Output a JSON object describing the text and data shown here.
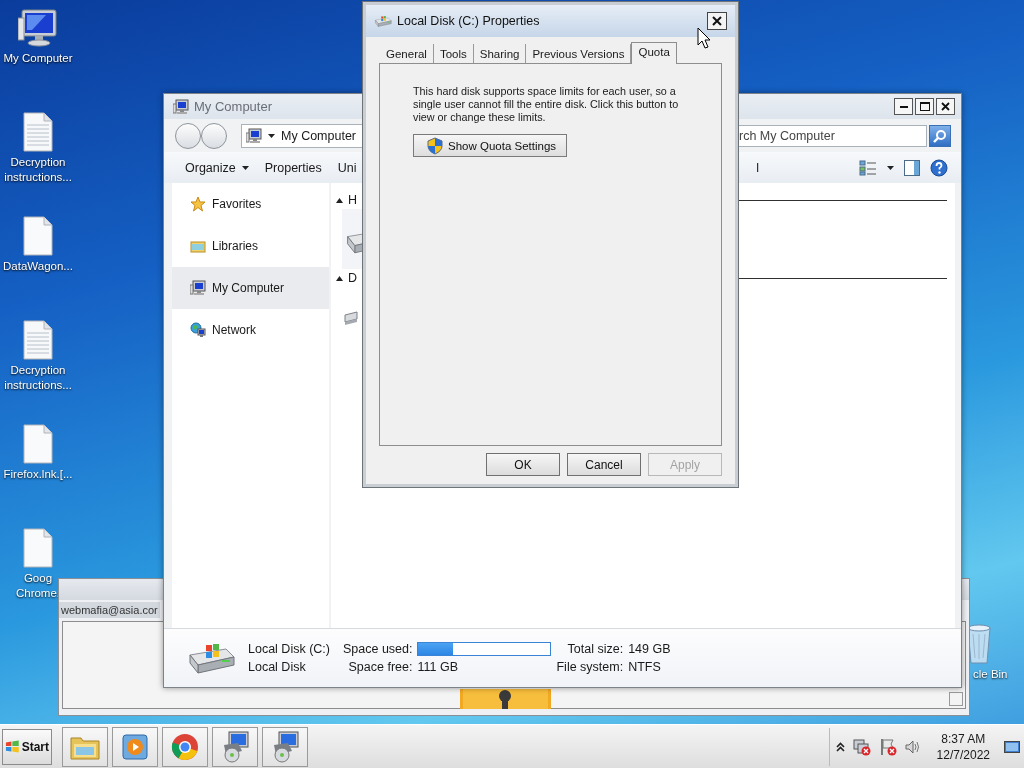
{
  "desktop": {
    "icons": [
      {
        "label": "My Computer",
        "kind": "computer"
      },
      {
        "label": "Decryption instructions...",
        "kind": "textfile"
      },
      {
        "label": "DataWagon...",
        "kind": "file"
      },
      {
        "label": "Decryption instructions...",
        "kind": "textfile"
      },
      {
        "label": "Firefox.lnk.[...",
        "kind": "file"
      },
      {
        "label": "Goog\nChrome.",
        "kind": "file"
      }
    ],
    "recycle_bin": {
      "label": "cle Bin"
    }
  },
  "background_window": {
    "field_value": "webmafia@asia.cor"
  },
  "explorer": {
    "title": "My Computer",
    "address": "My Computer",
    "search": {
      "placeholder": "rch My Computer"
    },
    "toolbar": [
      {
        "label": "Organize",
        "dropdown": true
      },
      {
        "label": "Properties",
        "dropdown": false
      },
      {
        "label": "Uni",
        "dropdown": false
      }
    ],
    "toolbar_fragment": "l",
    "nav": [
      {
        "label": "Favorites",
        "kind": "star",
        "selected": false
      },
      {
        "label": "Libraries",
        "kind": "library",
        "selected": false
      },
      {
        "label": "My Computer",
        "kind": "computer",
        "selected": true
      },
      {
        "label": "Network",
        "kind": "network",
        "selected": false
      }
    ],
    "groups": [
      {
        "label": "H",
        "expanded": true,
        "kind": "harddisk"
      },
      {
        "label": "D",
        "expanded": true,
        "kind": "removable"
      }
    ],
    "details": {
      "name": "Local Disk (C:)",
      "type": "Local Disk",
      "used_label": "Space used:",
      "level": 0.26,
      "free_label": "Space free:",
      "free": "111 GB",
      "total_label": "Total size:",
      "total": "149 GB",
      "fs_label": "File system:",
      "fs": "NTFS"
    }
  },
  "dialog": {
    "title": "Local Disk (C:) Properties",
    "tabs": [
      {
        "label": "General",
        "selected": false
      },
      {
        "label": "Tools",
        "selected": false
      },
      {
        "label": "Sharing",
        "selected": false
      },
      {
        "label": "Previous Versions",
        "selected": false
      },
      {
        "label": "Quota",
        "selected": true
      }
    ],
    "description": "This hard disk supports space limits for each user, so a single user cannot fill the entire disk. Click this button to view or change these limits.",
    "quota_button": "Show Quota Settings",
    "buttons": [
      {
        "label": "OK",
        "disabled": false
      },
      {
        "label": "Cancel",
        "disabled": false
      },
      {
        "label": "Apply",
        "disabled": true
      }
    ]
  },
  "taskbar": {
    "start": "Start",
    "apps": [
      {
        "kind": "folder"
      },
      {
        "kind": "media"
      },
      {
        "kind": "browser"
      },
      {
        "kind": "installer"
      },
      {
        "kind": "installer"
      }
    ],
    "tray": [
      {
        "kind": "chevron"
      },
      {
        "kind": "network"
      },
      {
        "kind": "flag"
      },
      {
        "kind": "volume"
      }
    ],
    "time": "8:37 AM",
    "date": "12/7/2022"
  }
}
